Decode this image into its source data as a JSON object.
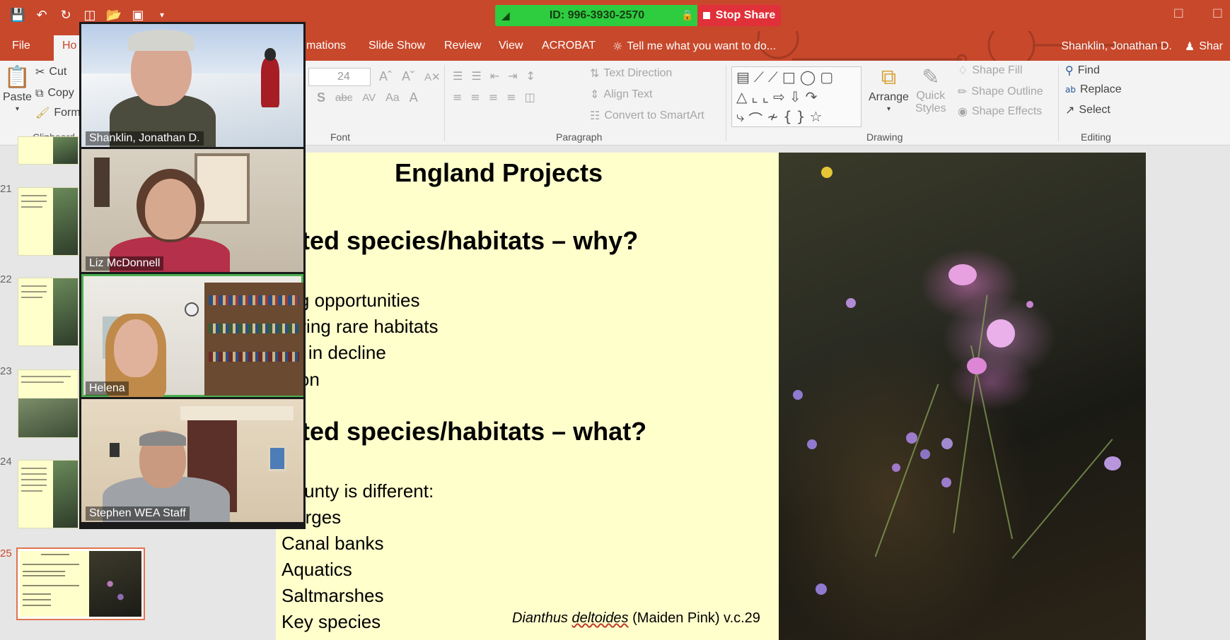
{
  "qat": {
    "icons": [
      "save-icon",
      "undo-icon",
      "redo-icon",
      "start-slideshow-icon",
      "open-icon",
      "new-icon",
      "customize-icon"
    ]
  },
  "zoom": {
    "meeting_id": "ID: 996-3930-2570",
    "stop_share": "Stop Share"
  },
  "menu": {
    "tabs": [
      "File",
      "Ho",
      "mations",
      "Slide Show",
      "Review",
      "View",
      "ACROBAT"
    ],
    "tell_me": "Tell me what you want to do...",
    "user": "Shanklin, Jonathan D.",
    "share": "Shar"
  },
  "ribbon": {
    "clipboard": {
      "paste": "Paste",
      "cut": "Cut",
      "copy": "Copy",
      "format": "Form",
      "label": "Clipboard"
    },
    "font": {
      "size": "24",
      "label": "Font",
      "case": "Aa"
    },
    "paragraph": {
      "text_direction": "Text Direction",
      "align_text": "Align Text",
      "convert_smartart": "Convert to SmartArt",
      "label": "Paragraph"
    },
    "drawing": {
      "arrange": "Arrange",
      "quick_styles_1": "Quick",
      "quick_styles_2": "Styles",
      "shape_fill": "Shape Fill",
      "shape_outline": "Shape Outline",
      "shape_effects": "Shape Effects",
      "label": "Drawing"
    },
    "editing": {
      "find": "Find",
      "replace": "Replace",
      "select": "Select",
      "label": "Editing"
    }
  },
  "thumbnails": {
    "numbers": [
      "21",
      "22",
      "23",
      "24",
      "25"
    ]
  },
  "participants": [
    {
      "name": "Shanklin, Jonathan D."
    },
    {
      "name": "Liz McDonnell"
    },
    {
      "name": "Helena"
    },
    {
      "name": "Stephen WEA Staff"
    }
  ],
  "slide": {
    "title": "England Projects",
    "heading1": "rgeted species/habitats – why?",
    "bullets1": [
      "aining opportunities",
      "onitoring rare habitats",
      "ecies in decline",
      "ucation"
    ],
    "heading2": "rgeted species/habitats – what?",
    "bullets2": [
      "ch county is different:",
      "ad verges",
      "Canal banks",
      "Aquatics",
      "Saltmarshes",
      "Key species"
    ],
    "caption_sci": "Dianthus",
    "caption_sci2": "deltoides",
    "caption_rest": " (Maiden Pink) v.c.29"
  }
}
